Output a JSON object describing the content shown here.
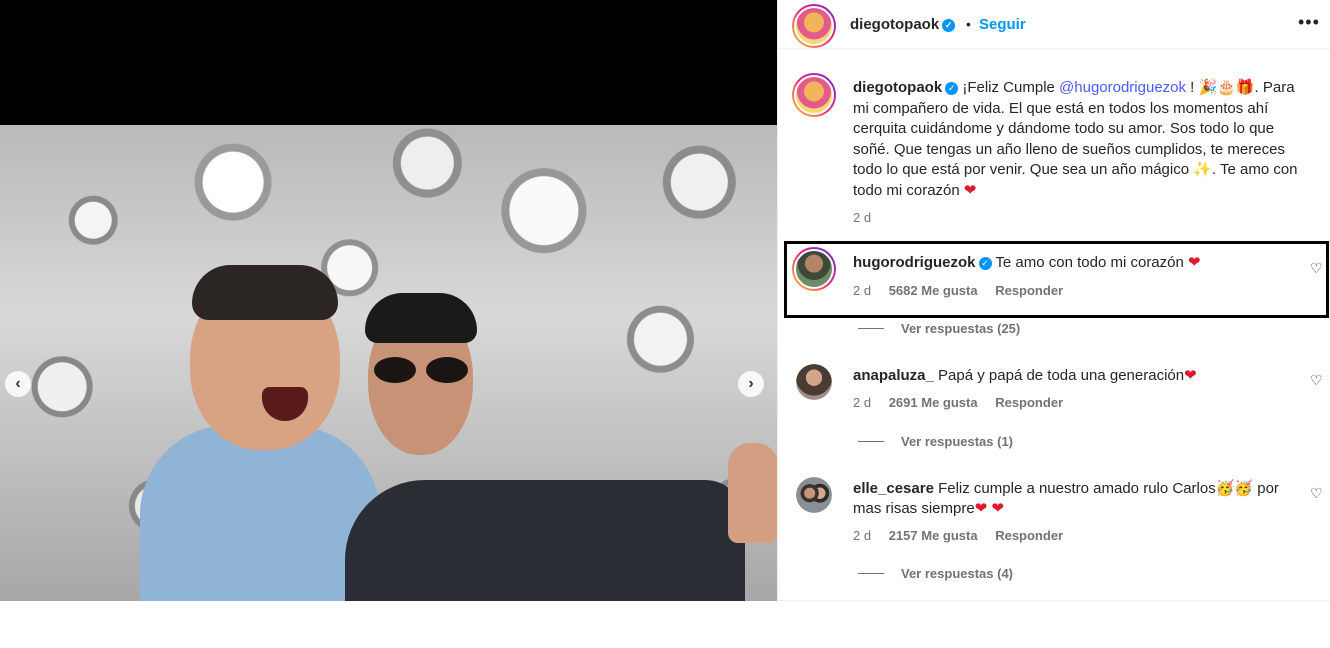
{
  "post": {
    "username": "diegotopaok",
    "separator": "•",
    "follow_label": "Seguir",
    "more_label": "•••",
    "verified_mark": "✓"
  },
  "caption": {
    "username": "diegotopaok",
    "prefix": "¡Feliz Cumple ",
    "mention": "@hugorodriguezok",
    "after_mention": " ! 🎉🎂🎁.",
    "body": "Para mi compañero de vida. El que está en todos los momentos ahí cerquita cuidándome y dándome todo su amor. Sos todo lo que soñé. Que tengas un año lleno de sueños cumplidos, te mereces todo lo que está por venir. Que sea un año mágico ✨.",
    "closing": "Te amo con todo mi corazón ",
    "closing_heart": "❤",
    "time": "2 d"
  },
  "comments": [
    {
      "username": "hugorodriguezok",
      "verified": true,
      "text": "Te amo con todo mi corazón ",
      "text_heart": "❤",
      "time": "2 d",
      "likes": "5682 Me gusta",
      "reply_label": "Responder",
      "view_replies": "Ver respuestas (25)"
    },
    {
      "username": "anapaluza_",
      "text": "Papá y papá de toda una generación",
      "text_heart": "❤",
      "time": "2 d",
      "likes": "2691 Me gusta",
      "reply_label": "Responder",
      "view_replies": "Ver respuestas (1)"
    },
    {
      "username": "elle_cesare",
      "text": "Feliz cumple a nuestro amado rulo Carlos🥳🥳 por mas risas siempre",
      "text_heart": "❤ ❤",
      "time": "2 d",
      "likes": "2157 Me gusta",
      "reply_label": "Responder",
      "view_replies": "Ver respuestas (4)"
    }
  ],
  "icons": {
    "like": "♡",
    "prev": "‹",
    "next": "›"
  },
  "colors": {
    "accent_blue": "#0095f6",
    "mention": "#4a5df9",
    "heart": "#e0182d",
    "muted": "#737373"
  }
}
